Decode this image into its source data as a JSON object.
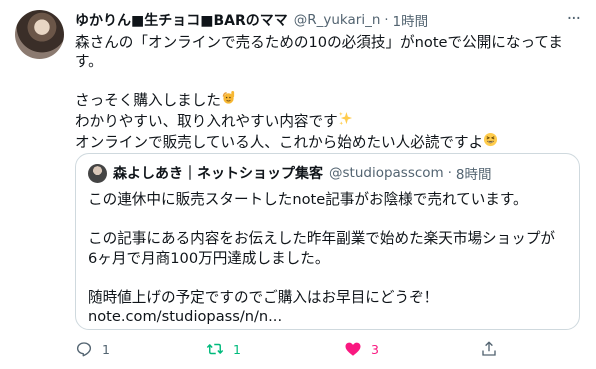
{
  "author": {
    "name": "ゆかりん■生チョコ■BARのママ",
    "handle": "@R_yukari_n",
    "time": "1時間"
  },
  "more_label": "···",
  "body": {
    "line1": "森さんの「オンラインで売るための10の必須技」がnoteで公開になってま",
    "line2": "す。",
    "line3": "さっそく購入しました",
    "line4": "わかりやすい、取り入れやすい内容です",
    "line5": "オンラインで販売している人、これから始めたい人必読ですよ",
    "emoji_icons": [
      "raising-hand-emoji-icon",
      "sparkles-emoji-icon",
      "grinning-squint-emoji-icon"
    ]
  },
  "quote": {
    "name": "森よしあき｜ネットショップ集客",
    "handle": "@studiopasscom",
    "time": "8時間",
    "line1": "この連休中に販売スタートしたnote記事がお陰様で売れています。",
    "line2": "この記事にある内容をお伝えした昨年副業で始めた楽天市場ショップが",
    "line3": "6ヶ月で月商100万円達成しました。",
    "line4": "随時値上げの予定ですのでご購入はお早目にどうぞ！",
    "line5": "note.com/studiopass/n/n..."
  },
  "actions": {
    "reply_count": "1",
    "retweet_count": "1",
    "like_count": "3"
  },
  "colors": {
    "text": "#0f1419",
    "secondary": "#536471",
    "retweet_green": "#00ba7c",
    "like_pink": "#f91880",
    "border": "#cfd9de"
  }
}
